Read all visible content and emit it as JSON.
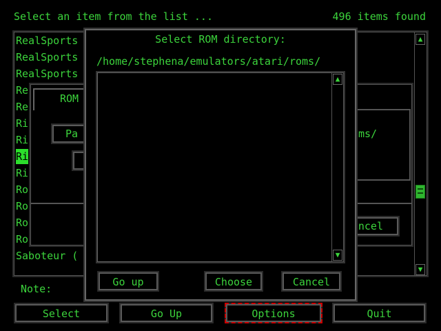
{
  "header": {
    "prompt": "Select an item from the list ...",
    "count": "496 items found"
  },
  "list": {
    "items": [
      {
        "label": "RealSports"
      },
      {
        "label": "RealSports"
      },
      {
        "label": "RealSports"
      },
      {
        "label": "Re"
      },
      {
        "label": "Re"
      },
      {
        "label": "Ri"
      },
      {
        "label": "Ri"
      },
      {
        "label": "Ri",
        "selected": true
      },
      {
        "label": "Ri"
      },
      {
        "label": "Ro"
      },
      {
        "label": "Ro"
      },
      {
        "label": "Ro"
      },
      {
        "label": "Ro"
      },
      {
        "label": "Saboteur ("
      }
    ],
    "up_arrow": "▲",
    "down_arrow": "▼"
  },
  "note_label": "Note:",
  "bottom_buttons": {
    "select": "Select",
    "go_up": "Go Up",
    "options": "Options",
    "quit": "Quit"
  },
  "background_dialog": {
    "title_partial": "ROM",
    "button_partial": "Pa",
    "path_partial": "ms/",
    "cancel_partial": "ancel"
  },
  "rom_dialog": {
    "title": "Select ROM directory:",
    "path": "/home/stephena/emulators/atari/roms/",
    "up_arrow": "▲",
    "down_arrow": "▼",
    "buttons": {
      "go_up": "Go up",
      "choose": "Choose",
      "cancel": "Cancel"
    }
  }
}
